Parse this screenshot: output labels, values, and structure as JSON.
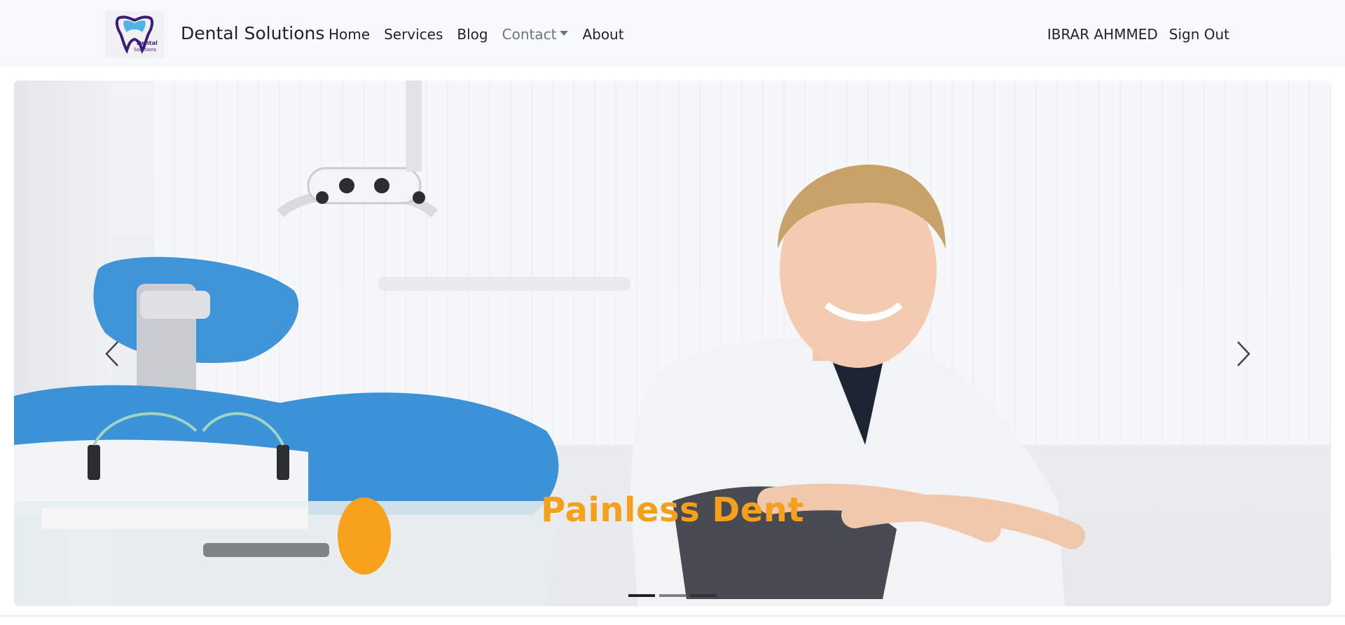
{
  "navbar": {
    "logo": {
      "text_top": "Dental",
      "text_bottom": "Solutions",
      "icon": "tooth-logo-icon"
    },
    "brand": "Dental Solutions",
    "links": [
      {
        "label": "Home"
      },
      {
        "label": "Services"
      },
      {
        "label": "Blog"
      },
      {
        "label": "Contact",
        "dropdown": true
      },
      {
        "label": "About"
      }
    ],
    "user": "IBRAR AHMMED",
    "signout": "Sign Out"
  },
  "carousel": {
    "caption": "Painless Dent",
    "caption_color": "#f4a01b",
    "slide_count": 3,
    "active_index": 0,
    "prev_icon": "chevron-left-icon",
    "next_icon": "chevron-right-icon"
  },
  "colors": {
    "navbar_bg": "#f8f9fa",
    "logo_primary": "#3b1c7a",
    "logo_accent": "#4fb3e8"
  }
}
